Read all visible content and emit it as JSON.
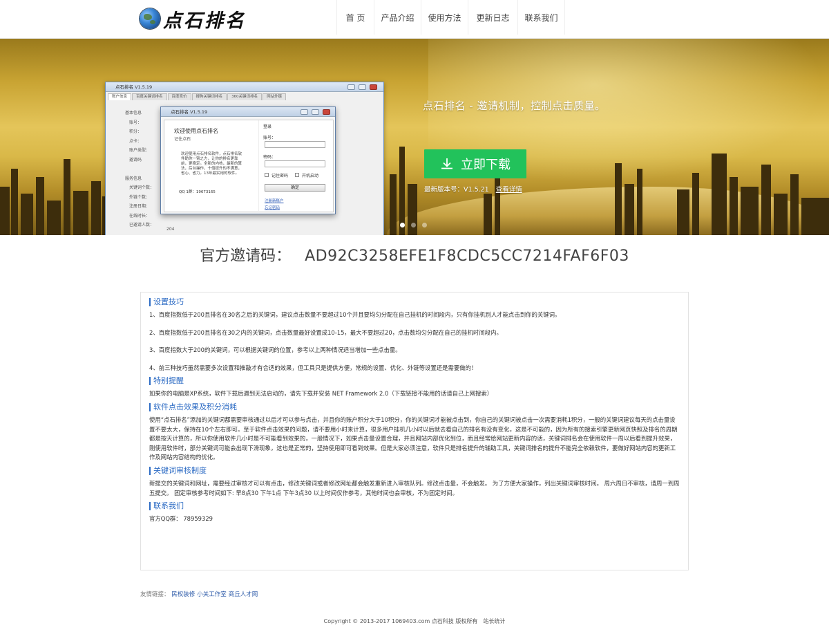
{
  "header": {
    "logo_text": "点石排名",
    "nav": [
      "首 页",
      "产品介绍",
      "使用方法",
      "更新日志",
      "联系我们"
    ]
  },
  "banner": {
    "slogan": "点石排名 - 邀请机制，控制点击质量。",
    "download_label": "立即下载",
    "version_label": "最新版本号：V1.5.21",
    "view_detail": "查看详情",
    "slide_count": 3,
    "active_slide": 0,
    "app": {
      "main_title": "点石排名 V1.5.19",
      "tabs": [
        "账户信息",
        "百度关键词排名",
        "百度竞价",
        "搜狗关键词排名",
        "360关键词排名",
        "网站外链"
      ],
      "side_labels": [
        "基本信息",
        "账号：",
        "积分：",
        "点卡：",
        "账户类型：",
        "邀请码",
        "",
        "服务信息",
        "关键词个数：",
        "外链个数：",
        "注册日期：",
        "在线时长：",
        "已邀请人数："
      ],
      "dialog_title": "点石排名 V1.5.19",
      "welcome": "欢迎使用点石排名",
      "welcome_sub": "记住点石",
      "body_text": "欢迎使用点石排名软件，点石排名软件助你一臂之力，让你的排名更靠前，更稳定。全新的内核，最新的算法，后台操作，十倍提升的不满意，省心、省力。13年最实用的软件。",
      "qq_line": "QQ 1群：19673165",
      "login_title": "登录",
      "account_label": "账号：",
      "password_label": "密码：",
      "remember_label": "记住密码",
      "autostart_label": "开机启动",
      "confirm_label": "确定",
      "register_link": "注册新账户",
      "forgot_link": "忘记密码",
      "invite_count": "204"
    }
  },
  "invite": {
    "label": "官方邀请码：",
    "code": "AD92C3258EFE1F8CDC5CC7214FAF6F03"
  },
  "sections": [
    {
      "title": "设置技巧",
      "paras": [
        "1、百度指数低于200且排名在30名之后的关键词，建议点击数量不要超过10个并且要均匀分配在自己挂机的时间段内，只有你挂机别人才能点击到你的关键词。",
        "2、百度指数低于200且排名在30之内的关键词，点击数量最好设置成10-15，最大不要超过20，点击数均匀分配在自己的挂机时间段内。",
        "3、百度指数大于200的关键词，可以根据关键词的位置，参考以上两种情况适当增加一些点击量。",
        "4、前三种技巧虽然需要多次设置和推敲才有合适的效果，但工具只是提供方便，常规的设置、优化、外链等设置还是需要做的！"
      ]
    },
    {
      "title": "特别提醒",
      "paras": [
        "如果你的电脑是XP系统，软件下载后遇到无法启动的，请先下载并安装 NET Framework 2.0（下载链接不能用的话请自己上网搜索）"
      ]
    },
    {
      "title": "软件点击效果及积分消耗",
      "paras": [
        "使用“点石排名”添加的关键词都需要审核通过以后才可以参与点击，并且你的账户积分大于10积分，你的关键词才能被点击到，你自己的关键词被点击一次需要消耗1积分，一般的关键词建议每天的点击量设置不要太大，保持在10个左右即可。至于软件点击效果的问题，请不要用小时来计算，很多用户挂机几小时以后就去看自己的排名有没有变化，这是不可能的，因为所有的搜索引擎更新网页快照及排名的周期都是按天计算的，所以你使用软件几小时是不可能看到效果的，一般情况下，如果点击量设置合理，并且网站内部优化到位，而且经常给网站更新内容的话，关键词排名会在使用软件一周以后看到提升效果，刚使用软件时，部分关键词可能会出现下滑现象，这也是正常的，坚持使用即可看到效果。但是大家必须注意，软件只是排名提升的辅助工具，关键词排名的提升不能完全依赖软件，要做好网站内容的更新工作及网站内容结构的优化。"
      ]
    },
    {
      "title": "关键词审核制度",
      "paras": [
        "新提交的关键词和网址，需要经过审核才可以有点击，修改关键词或者修改网址都会触发重新进入审核队列。修改点击量，不会触发。 为了方便大家操作，列出关键词审核时间。 周六周日不审核，请周一到周五提交。 固定审核参考时间如下: 早8点30 下午1点 下午3点30 以上时间仅作参考，其他时间也会审核，不为固定时间。"
      ]
    },
    {
      "title": "联系我们",
      "paras": [
        "官方QQ群： 78959329"
      ]
    }
  ],
  "footer": {
    "friend_label": "友情链接：",
    "friend_links": [
      "民权装修",
      "小关工作室",
      "商丘人才网"
    ],
    "copyright": "Copyright © 2013-2017 1069403.com 点石科技 版权所有",
    "stat": "站长统计"
  }
}
